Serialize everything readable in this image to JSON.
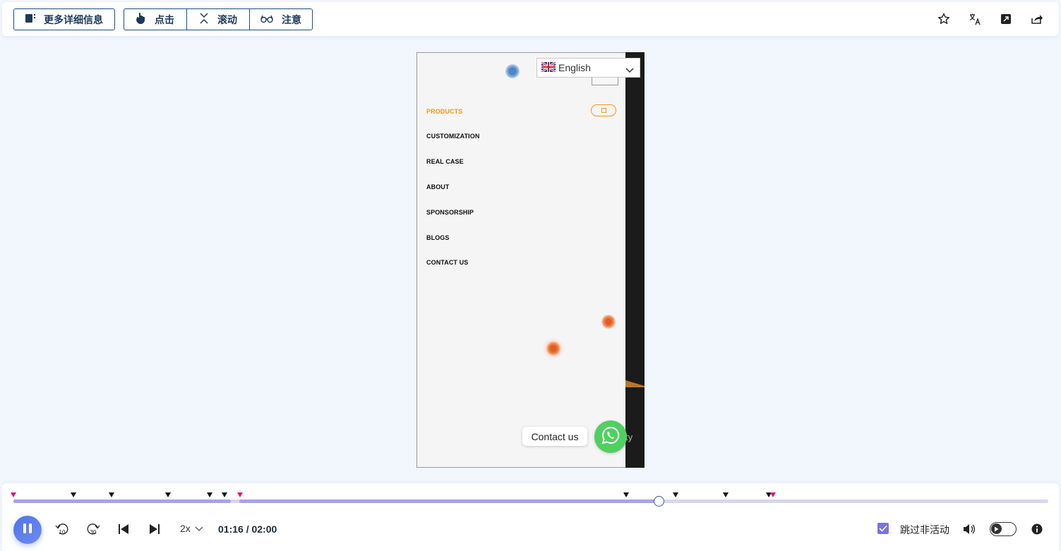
{
  "toolbar": {
    "more_info_label": "更多详细信息",
    "click_label": "点击",
    "scroll_label": "滚动",
    "attention_label": "注意",
    "accent_color": "#1e4f7a"
  },
  "viewport": {
    "language": "English",
    "menu": [
      {
        "label": "PRODUCTS",
        "active": true
      },
      {
        "label": "CUSTOMIZATION",
        "active": false
      },
      {
        "label": "REAL CASE",
        "active": false
      },
      {
        "label": "ABOUT",
        "active": false
      },
      {
        "label": "SPONSORSHIP",
        "active": false
      },
      {
        "label": "BLOGS",
        "active": false
      },
      {
        "label": "CONTACT US",
        "active": false
      }
    ],
    "active_color": "#f0961e",
    "contact_label": "Contact us",
    "partial_text": "ty"
  },
  "player": {
    "time_display": "01:16 / 02:00",
    "progress_fraction": 0.6333,
    "speed": "2x",
    "skip_inactive_label": "跳过非活动",
    "skip_inactive_checked": true,
    "rewind_label": "10",
    "forward_label": "30",
    "accent_color": "#7a73e0"
  }
}
